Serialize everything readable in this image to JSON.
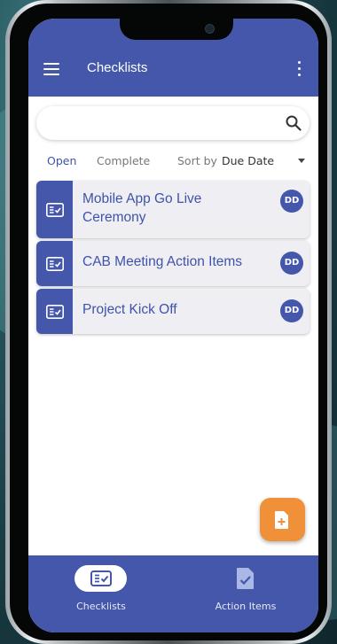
{
  "appbar": {
    "title": "Checklists"
  },
  "search": {
    "value": "",
    "placeholder": ""
  },
  "filters": {
    "open": "Open",
    "complete": "Complete",
    "sort_label": "Sort by",
    "sort_value": "Due Date"
  },
  "checklists": [
    {
      "title": "Mobile App Go Live Ceremony",
      "badge": "DD"
    },
    {
      "title": "CAB Meeting Action Items",
      "badge": "DD"
    },
    {
      "title": "Project Kick Off",
      "badge": "DD"
    }
  ],
  "bottom_nav": {
    "items": [
      {
        "label": "Checklists",
        "icon": "checklist-icon",
        "active": true
      },
      {
        "label": "Action Items",
        "icon": "action-items-icon",
        "active": false
      }
    ]
  },
  "colors": {
    "primary": "#4457ab",
    "accent": "#f0913a",
    "card_bg": "#eeeef3"
  }
}
